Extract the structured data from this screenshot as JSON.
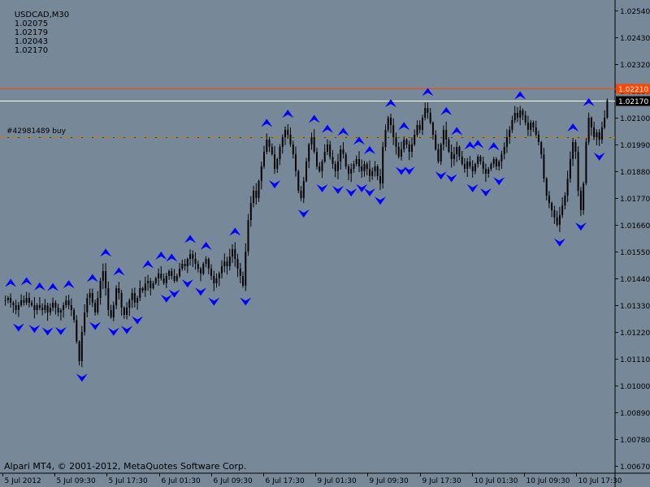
{
  "header": {
    "symbol_label": "USDCAD,M30",
    "open": "1.02075",
    "high": "1.02179",
    "low": "1.02043",
    "close": "1.02170"
  },
  "order": {
    "label": "#42981489 buy",
    "price": 1.0202
  },
  "footer": {
    "copyright": "Alpari MT4, © 2001-2012, MetaQuotes Software Corp."
  },
  "colors": {
    "background": "#778899",
    "candle": "#000000",
    "fractal_up": "#0000ff",
    "fractal_down": "#0000ff",
    "ask_line": "#ff4500",
    "bid_line": "#ffffff",
    "order_line": "#cc7a00",
    "order_dash": "#006400",
    "price_badge": "#ff4500",
    "bid_badge": "#000000",
    "axis_text": "#000000"
  },
  "chart_data": {
    "type": "candlestick",
    "symbol": "USDCAD",
    "timeframe": "M30",
    "ylim": [
      1.0064,
      1.0258
    ],
    "y_ticks": [
      "1.02540",
      "1.02430",
      "1.02320",
      "1.02210",
      "1.02100",
      "1.01990",
      "1.01880",
      "1.01770",
      "1.01660",
      "1.01550",
      "1.01440",
      "1.01330",
      "1.01220",
      "1.01110",
      "1.01000",
      "1.00890",
      "1.00780",
      "1.00670"
    ],
    "x_ticks": [
      "5 Jul 2012",
      "5 Jul 09:30",
      "5 Jul 17:30",
      "6 Jul 01:30",
      "6 Jul 09:30",
      "6 Jul 17:30",
      "9 Jul 01:30",
      "9 Jul 09:30",
      "9 Jul 17:30",
      "10 Jul 01:30",
      "10 Jul 09:30",
      "10 Jul 17:30"
    ],
    "ask_price": 1.0222,
    "bid_price": "1.02170",
    "bid_value": 1.0217,
    "ask_badge_label": "1.02210",
    "close_series": [
      1.0135,
      1.0136,
      1.0134,
      1.0133,
      1.0131,
      1.0133,
      1.0135,
      1.0134,
      1.0136,
      1.0134,
      1.0133,
      1.0131,
      1.0133,
      1.0132,
      1.0131,
      1.0133,
      1.013,
      1.0132,
      1.0134,
      1.0132,
      1.013,
      1.0131,
      1.0133,
      1.0135,
      1.0133,
      1.0131,
      1.0127,
      1.0118,
      1.011,
      1.0122,
      1.013,
      1.0136,
      1.0138,
      1.0134,
      1.013,
      1.0136,
      1.0143,
      1.0147,
      1.014,
      1.0131,
      1.0128,
      1.0133,
      1.014,
      1.0138,
      1.0132,
      1.0129,
      1.0132,
      1.0135,
      1.0138,
      1.0134,
      1.0136,
      1.014,
      1.0139,
      1.0142,
      1.0143,
      1.014,
      1.0142,
      1.0144,
      1.0146,
      1.0144,
      1.0142,
      1.0145,
      1.0147,
      1.0145,
      1.0143,
      1.0145,
      1.0148,
      1.015,
      1.0149,
      1.0152,
      1.0154,
      1.0152,
      1.015,
      1.0148,
      1.0146,
      1.015,
      1.0152,
      1.0148,
      1.0145,
      1.0142,
      1.0144,
      1.0146,
      1.0149,
      1.0151,
      1.0149,
      1.0153,
      1.0156,
      1.0152,
      1.0148,
      1.0145,
      1.0141,
      1.0155,
      1.0168,
      1.0175,
      1.018,
      1.0177,
      1.0184,
      1.019,
      1.0196,
      1.0201,
      1.0198,
      1.0195,
      1.0189,
      1.0193,
      1.0198,
      1.0202,
      1.0205,
      1.0203,
      1.0199,
      1.0195,
      1.0188,
      1.018,
      1.0177,
      1.0184,
      1.0192,
      1.0199,
      1.0202,
      1.0196,
      1.019,
      1.0188,
      1.0192,
      1.0196,
      1.0199,
      1.0194,
      1.0191,
      1.0188,
      1.0192,
      1.0197,
      1.0195,
      1.019,
      1.0187,
      1.0189,
      1.0191,
      1.0193,
      1.019,
      1.0188,
      1.0191,
      1.0189,
      1.0186,
      1.0188,
      1.019,
      1.0186,
      1.0183,
      1.0198,
      1.0205,
      1.021,
      1.0207,
      1.0202,
      1.0198,
      1.0194,
      1.0197,
      1.0201,
      1.0199,
      1.0196,
      1.0199,
      1.0203,
      1.0207,
      1.0205,
      1.021,
      1.0214,
      1.0212,
      1.0208,
      1.0203,
      1.0197,
      1.0192,
      1.0199,
      1.0205,
      1.0201,
      1.0196,
      1.0193,
      1.0195,
      1.0198,
      1.0194,
      1.0191,
      1.0189,
      1.0192,
      1.019,
      1.0188,
      1.0191,
      1.0194,
      1.0192,
      1.0189,
      1.0187,
      1.0189,
      1.0191,
      1.0193,
      1.019,
      1.0192,
      1.0195,
      1.0198,
      1.0202,
      1.0205,
      1.0209,
      1.0212,
      1.021,
      1.0213,
      1.0211,
      1.0208,
      1.0205,
      1.0208,
      1.0206,
      1.0203,
      1.02,
      1.0195,
      1.0185,
      1.0178,
      1.0175,
      1.0172,
      1.0169,
      1.0166,
      1.017,
      1.0174,
      1.0178,
      1.0185,
      1.0193,
      1.02,
      1.0196,
      1.018,
      1.0172,
      1.0183,
      1.02,
      1.021,
      1.0206,
      1.0202,
      1.0204,
      1.0201,
      1.0206,
      1.021,
      1.0217
    ]
  }
}
